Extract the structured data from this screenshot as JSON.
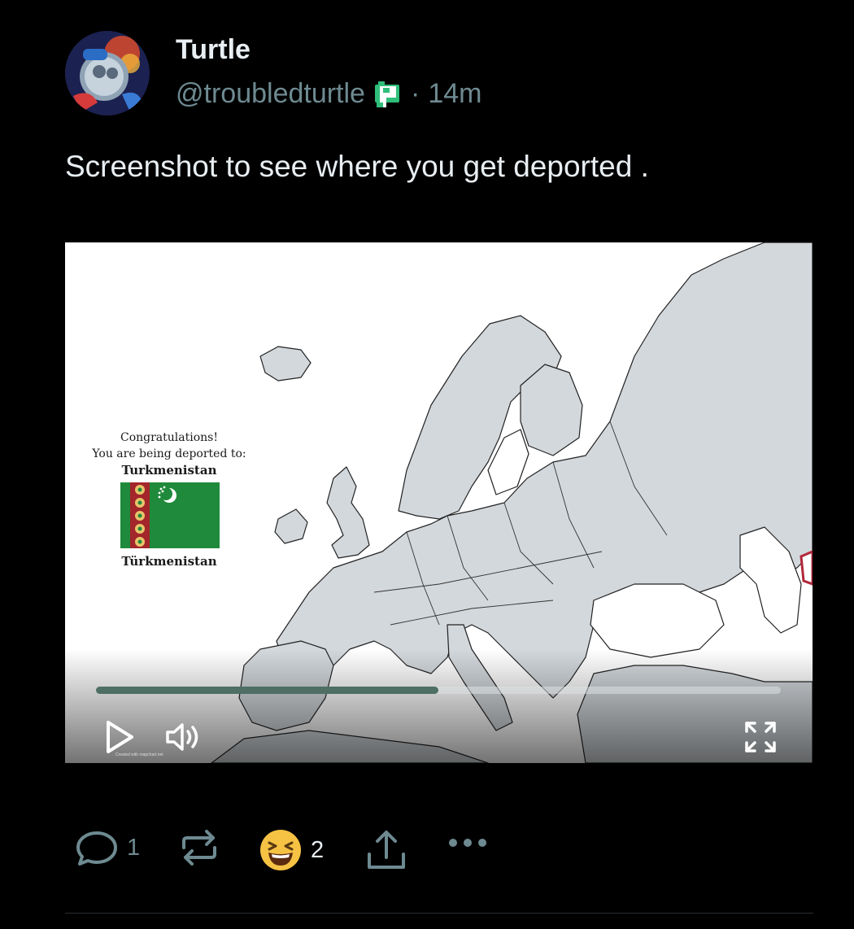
{
  "author": {
    "display_name": "Turtle",
    "handle": "@troubledturtle",
    "separator": "·",
    "timestamp": "14m",
    "badge_icon": "p-badge-icon"
  },
  "post": {
    "text": "Screenshot to see where you get deported ."
  },
  "video": {
    "overlay": {
      "line1": "Congratulations!",
      "line2": "You are being deported to:",
      "country": "Turkmenistan",
      "country_native": "Türkmenistan"
    },
    "watermark": "Created with mapchart.net",
    "progress": 0.5,
    "colors": {
      "progress_fill": "#4f6f64",
      "land": "#d3d8dc",
      "sea": "#ffffff",
      "flag_green": "#1f8a3b"
    }
  },
  "actions": {
    "replies": "1",
    "reactions": "2",
    "icons": [
      "reply-icon",
      "repost-icon",
      "laugh-emoji-icon",
      "share-icon",
      "more-icon"
    ]
  },
  "colors": {
    "background": "#000000",
    "text": "#e8eef2",
    "muted": "#6e8a91",
    "badge": "#2fbf7a"
  }
}
